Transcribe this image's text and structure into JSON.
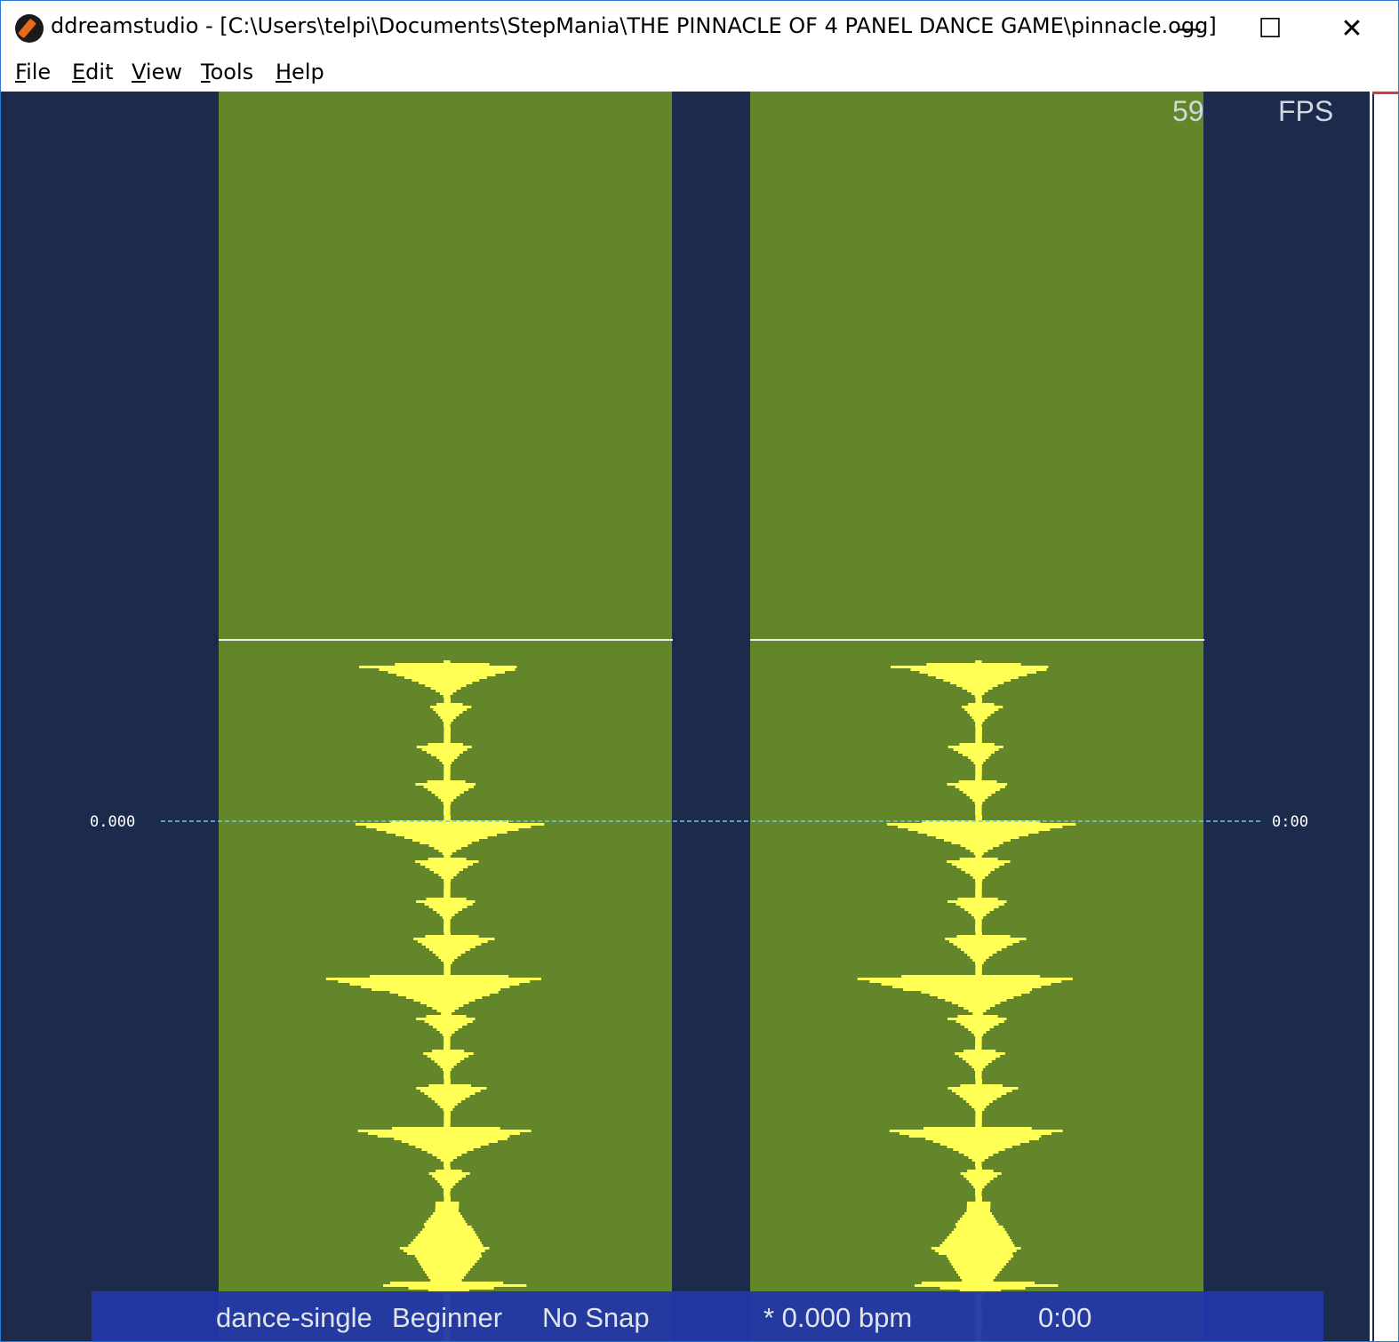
{
  "window": {
    "title": "ddreamstudio - [C:\\Users\\telpi\\Documents\\StepMania\\THE PINNACLE OF 4 PANEL DANCE GAME\\pinnacle.ogg]",
    "minimize_glyph": "—",
    "maximize_glyph": "☐",
    "close_glyph": "✕"
  },
  "menu": [
    {
      "mnemonic": "F",
      "rest": "ile"
    },
    {
      "mnemonic": "E",
      "rest": "dit"
    },
    {
      "mnemonic": "V",
      "rest": "iew"
    },
    {
      "mnemonic": "T",
      "rest": "ools"
    },
    {
      "mnemonic": "H",
      "rest": "elp"
    }
  ],
  "editor": {
    "fps_value": "59",
    "fps_label": "FPS",
    "cursor_beat": "0.000",
    "cursor_time": "0:00"
  },
  "status": {
    "style": "dance-single",
    "difficulty": "Beginner",
    "snap": "No Snap",
    "bpm": "* 0.000 bpm",
    "time": "0:00"
  },
  "colors": {
    "background": "#1c2a4b",
    "lane": "#63862b",
    "waveform": "#ffff55",
    "cursor_line": "#55d6e8",
    "status_bar": "#2236a8",
    "window_border": "#2b78d4"
  },
  "icons": [
    "app-icon",
    "minimize-icon",
    "maximize-icon",
    "close-icon"
  ]
}
